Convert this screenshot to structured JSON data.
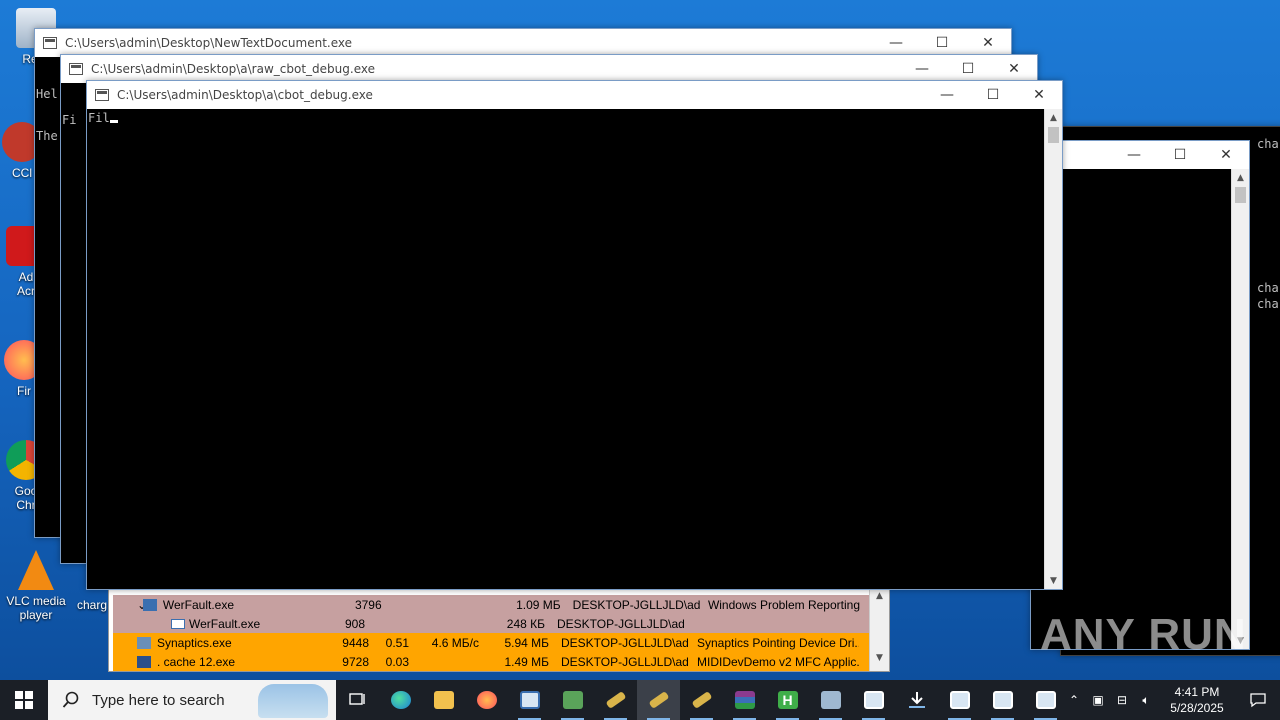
{
  "desktop": {
    "icons": [
      {
        "label": "Recy",
        "name": "recycle-bin-icon"
      },
      {
        "label": "CCl",
        "name": "ccleaner-icon"
      },
      {
        "label": "Ad\nAcr",
        "name": "adobe-acrobat-icon"
      },
      {
        "label": "Fir",
        "name": "firefox-icon"
      },
      {
        "label": "Goo\nChr",
        "name": "chrome-icon"
      },
      {
        "label": "VLC media\nplayer",
        "name": "vlc-icon"
      },
      {
        "label": "charg",
        "name": "charg-file-icon"
      }
    ],
    "watermark": "ANY RUN"
  },
  "windows": {
    "back": {
      "title": "C:\\Users\\admin\\Desktop\\NewTextDocument.exe",
      "console_lines": [
        "Hel",
        "The"
      ]
    },
    "middle": {
      "title": "C:\\Users\\admin\\Desktop\\a\\raw_cbot_debug.exe",
      "console_lines": [
        "Fi"
      ]
    },
    "front": {
      "title": "C:\\Users\\admin\\Desktop\\a\\cbot_debug.exe",
      "console_text": "Fil"
    },
    "right": {
      "console_lines_top": [
        "cha"
      ],
      "console_lines_mid": [
        "cha",
        "cha"
      ]
    },
    "controls": {
      "minimize": "—",
      "maximize": "☐",
      "close": "✕"
    }
  },
  "taskmgr": {
    "rows": [
      {
        "indent": 1,
        "expand": "⌄",
        "name": "WerFault.exe",
        "pid": "3796",
        "cpu": "",
        "disk": "",
        "mem": "1.09 МБ",
        "user": "DESKTOP-JGLLJLD\\admi",
        "desc": "Windows Problem Reporting",
        "bg": "#c6a0a0"
      },
      {
        "indent": 2,
        "expand": "",
        "name": "WerFault.exe",
        "pid": "908",
        "cpu": "",
        "disk": "",
        "mem": "248 КБ",
        "user": "DESKTOP-JGLLJLD\\admi",
        "desc": "",
        "bg": "#c6a0a0"
      },
      {
        "indent": 0,
        "expand": "",
        "name": "Synaptics.exe",
        "pid": "9448",
        "cpu": "0.51",
        "disk": "4.6 МБ/с",
        "mem": "5.94 МБ",
        "user": "DESKTOP-JGLLJLD\\admi",
        "desc": "Synaptics Pointing Device Dri...",
        "bg": "#ffa500"
      },
      {
        "indent": 0,
        "expand": "",
        "name": ". cache 12.exe",
        "pid": "9728",
        "cpu": "0.03",
        "disk": "",
        "mem": "1.49 МБ",
        "user": "DESKTOP-JGLLJLD\\admi",
        "desc": "MIDIDevDemo v2 MFC Applic...",
        "bg": "#ffa500"
      }
    ]
  },
  "taskbar": {
    "search_placeholder": "Type here to search",
    "apps": [
      {
        "name": "task-view-icon",
        "color": "#ffffff"
      },
      {
        "name": "edge-icon",
        "color": "#2ba3e0"
      },
      {
        "name": "file-explorer-icon",
        "color": "#f2c14e"
      },
      {
        "name": "firefox-icon",
        "color": "#ff7139"
      },
      {
        "name": "app-window-icon",
        "color": "#d8e6f3"
      },
      {
        "name": "terminal-app-icon",
        "color": "#5aa35a"
      },
      {
        "name": "key-app-icon",
        "color": "#d9b44a"
      },
      {
        "name": "key-app-active-icon",
        "color": "#d9b44a"
      },
      {
        "name": "key-app-2-icon",
        "color": "#d9b44a"
      },
      {
        "name": "winrar-icon",
        "color": "#8b3b8f"
      },
      {
        "name": "hex-editor-icon",
        "color": "#3fae49"
      },
      {
        "name": "process-tool-icon",
        "color": "#9fb8d0"
      },
      {
        "name": "console-window-icon",
        "color": "#d8e6f3"
      },
      {
        "name": "download-icon",
        "color": "#ffffff"
      },
      {
        "name": "console-window-2-icon",
        "color": "#d8e6f3"
      },
      {
        "name": "console-window-3-icon",
        "color": "#d8e6f3"
      },
      {
        "name": "console-window-4-icon",
        "color": "#d8e6f3"
      }
    ],
    "clock_time": "4:41 PM",
    "clock_date": "5/28/2025"
  }
}
